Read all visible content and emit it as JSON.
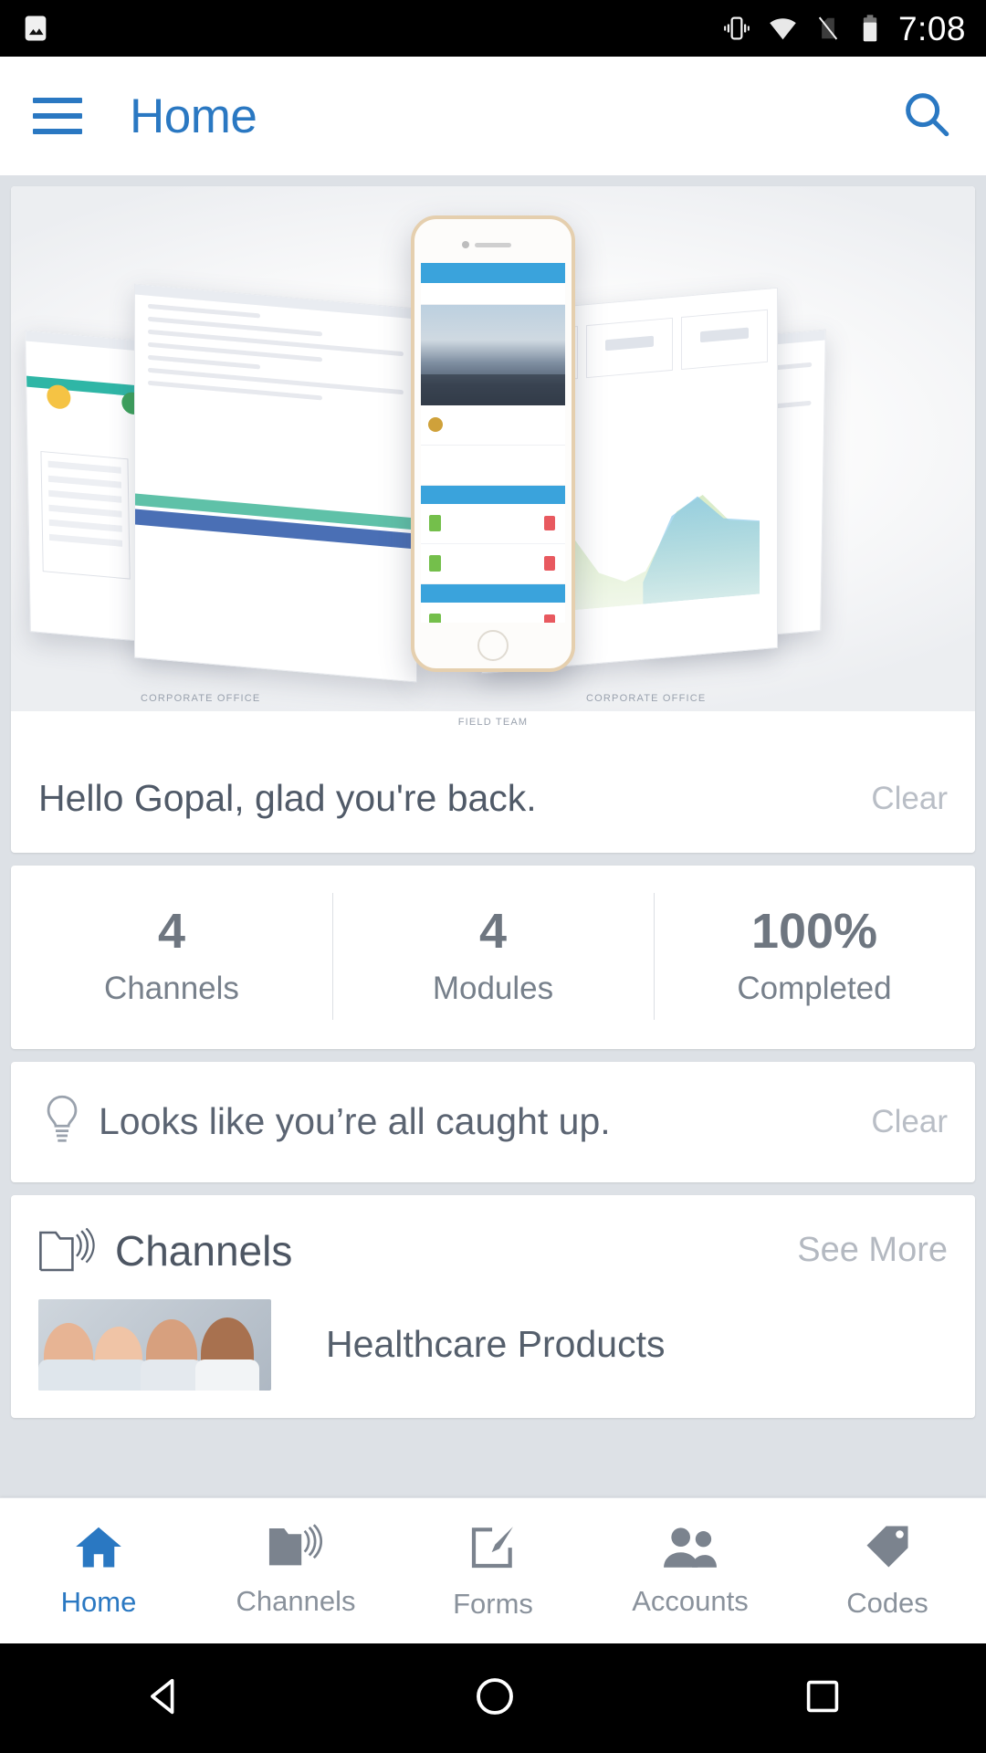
{
  "status_bar": {
    "time": "7:08",
    "icons": [
      "image-icon",
      "vibrate-icon",
      "wifi-icon",
      "no-sim-icon",
      "battery-icon"
    ]
  },
  "app_bar": {
    "menu_icon": "hamburger-menu-icon",
    "title": "Home",
    "search_icon": "search-icon",
    "accent_color": "#2a78c2"
  },
  "hero": {
    "caption_left": "CORPORATE OFFICE",
    "caption_right": "CORPORATE OFFICE",
    "caption_center": "FIELD TEAM"
  },
  "greeting": {
    "text": "Hello Gopal, glad you're back.",
    "clear_label": "Clear"
  },
  "stats": [
    {
      "value": "4",
      "label": "Channels"
    },
    {
      "value": "4",
      "label": "Modules"
    },
    {
      "value": "100%",
      "label": "Completed"
    }
  ],
  "caught_up": {
    "icon": "lightbulb-icon",
    "text": "Looks like you’re all caught up.",
    "clear_label": "Clear"
  },
  "channels_section": {
    "icon": "channel-folder-icon",
    "title": "Channels",
    "see_more_label": "See More",
    "items": [
      {
        "name": "Healthcare Products",
        "thumbnail": "healthcare-team-photo"
      }
    ]
  },
  "bottom_nav": {
    "items": [
      {
        "label": "Home",
        "icon": "home-icon",
        "active": true
      },
      {
        "label": "Channels",
        "icon": "folder-signal-icon",
        "active": false
      },
      {
        "label": "Forms",
        "icon": "form-edit-icon",
        "active": false
      },
      {
        "label": "Accounts",
        "icon": "people-icon",
        "active": false
      },
      {
        "label": "Codes",
        "icon": "tag-icon",
        "active": false
      }
    ]
  },
  "android_nav": {
    "back": "back-triangle-icon",
    "home": "home-circle-icon",
    "recents": "recents-square-icon"
  }
}
